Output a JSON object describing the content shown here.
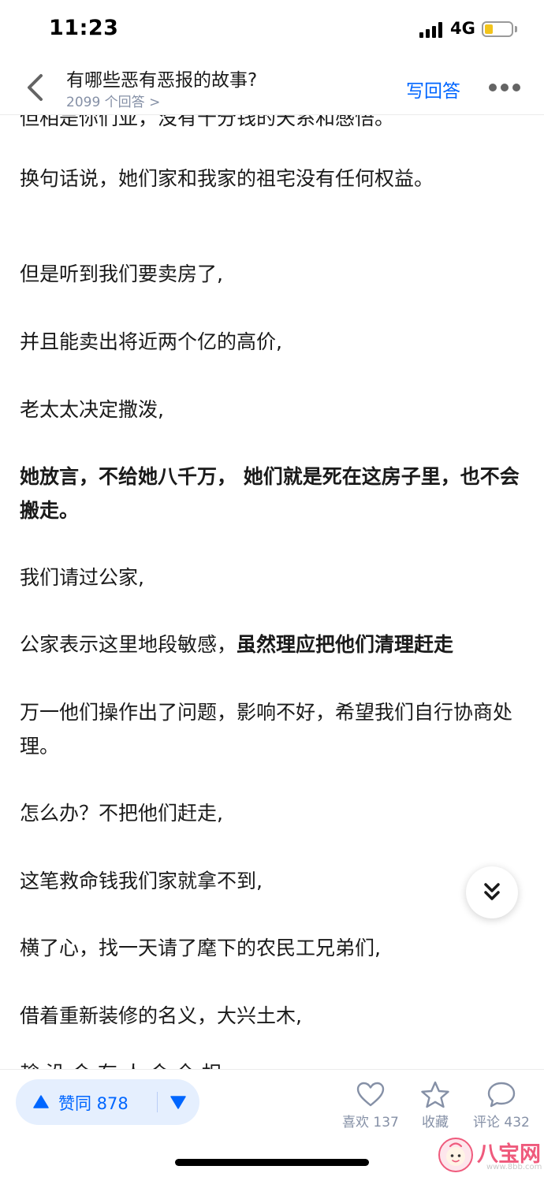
{
  "status_bar": {
    "time": "11:23",
    "network": "4G"
  },
  "header": {
    "title": "有哪些恶有恶报的故事?",
    "answer_count": "2099 个回答 >",
    "write_answer": "写回答"
  },
  "content": {
    "cut_line": "但相是你们亚，没有十分钱的天系和感悟。",
    "paragraphs": [
      {
        "text": "换句话说，她们家和我家的祖宅没有任何权益。"
      },
      {
        "text": "但是听到我们要卖房了,"
      },
      {
        "text": "并且能卖出将近两个亿的高价,"
      },
      {
        "text": "老太太决定撒泼,"
      },
      {
        "text": "她放言，不给她八千万， 她们就是死在这房子里，也不会搬走。"
      },
      {
        "text": "我们请过公家,"
      },
      {
        "normal": "公家表示这里地段敏感，",
        "bold": "虽然理应把他们清理赶走"
      },
      {
        "text": "万一他们操作出了问题，影响不好，希望我们自行协商处理。"
      },
      {
        "text": "怎么办？不把他们赶走,"
      },
      {
        "text": "这笔救命钱我们家就拿不到,"
      },
      {
        "text": "横了心，找一天请了麾下的农民工兄弟们,"
      },
      {
        "text": "借着重新装修的名义，大兴土木,"
      }
    ],
    "partial_line": "趁 没 会 有 人 会 全 相"
  },
  "bottom_bar": {
    "vote_up_label": "赞同 878",
    "like_label": "喜欢 137",
    "favorite_label": "收藏",
    "comment_label": "评论 432"
  },
  "watermark": {
    "text": "八宝网",
    "url": "www.8bb.com"
  },
  "colors": {
    "accent": "#0066ff",
    "vote_bg": "#e5effe",
    "meta_gray": "#8590a6",
    "watermark_pink": "#ef5a7c"
  },
  "icons": [
    "chevron-left-icon",
    "more-dots-icon",
    "chevrons-down-icon",
    "triangle-up-icon",
    "triangle-down-icon",
    "heart-icon",
    "star-icon",
    "comment-bubble-icon"
  ]
}
